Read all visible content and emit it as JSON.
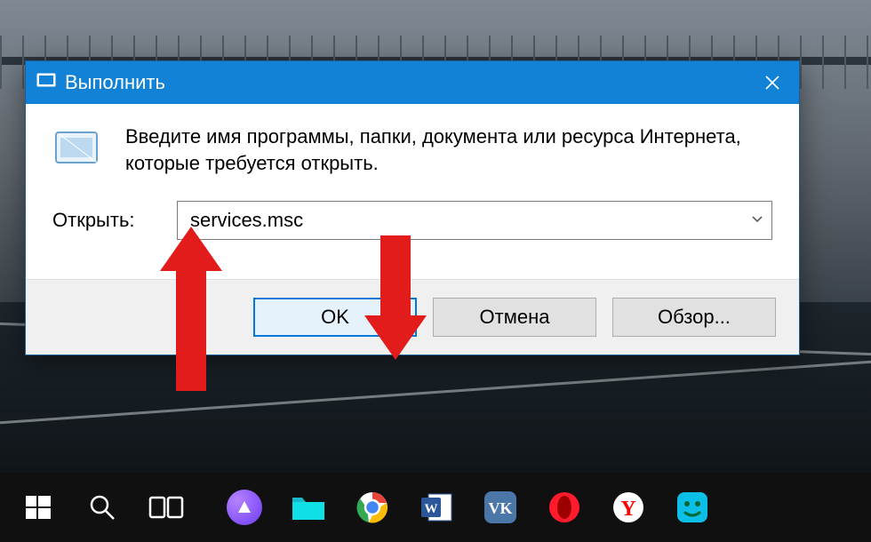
{
  "dialog": {
    "title": "Выполнить",
    "description": "Введите имя программы, папки, документа или ресурса Интернета, которые требуется открыть.",
    "open_label": "Открыть:",
    "input_value": "services.msc",
    "buttons": {
      "ok": "OK",
      "cancel": "Отмена",
      "browse": "Обзор..."
    }
  },
  "taskbar": {
    "items": [
      {
        "name": "start-button",
        "icon": "windows"
      },
      {
        "name": "search-button",
        "icon": "magnifier"
      },
      {
        "name": "taskview-button",
        "icon": "taskview"
      },
      {
        "name": "alice-button",
        "icon": "alice"
      },
      {
        "name": "files-button",
        "icon": "folder"
      },
      {
        "name": "chrome-button",
        "icon": "chrome"
      },
      {
        "name": "word-button",
        "icon": "word"
      },
      {
        "name": "vk-button",
        "icon": "vk"
      },
      {
        "name": "opera-button",
        "icon": "opera"
      },
      {
        "name": "yandex-button",
        "icon": "yandex"
      },
      {
        "name": "bluestacks-button",
        "icon": "bluestacks"
      }
    ]
  },
  "colors": {
    "accent": "#1282d6",
    "arrow": "#e21b1b"
  }
}
